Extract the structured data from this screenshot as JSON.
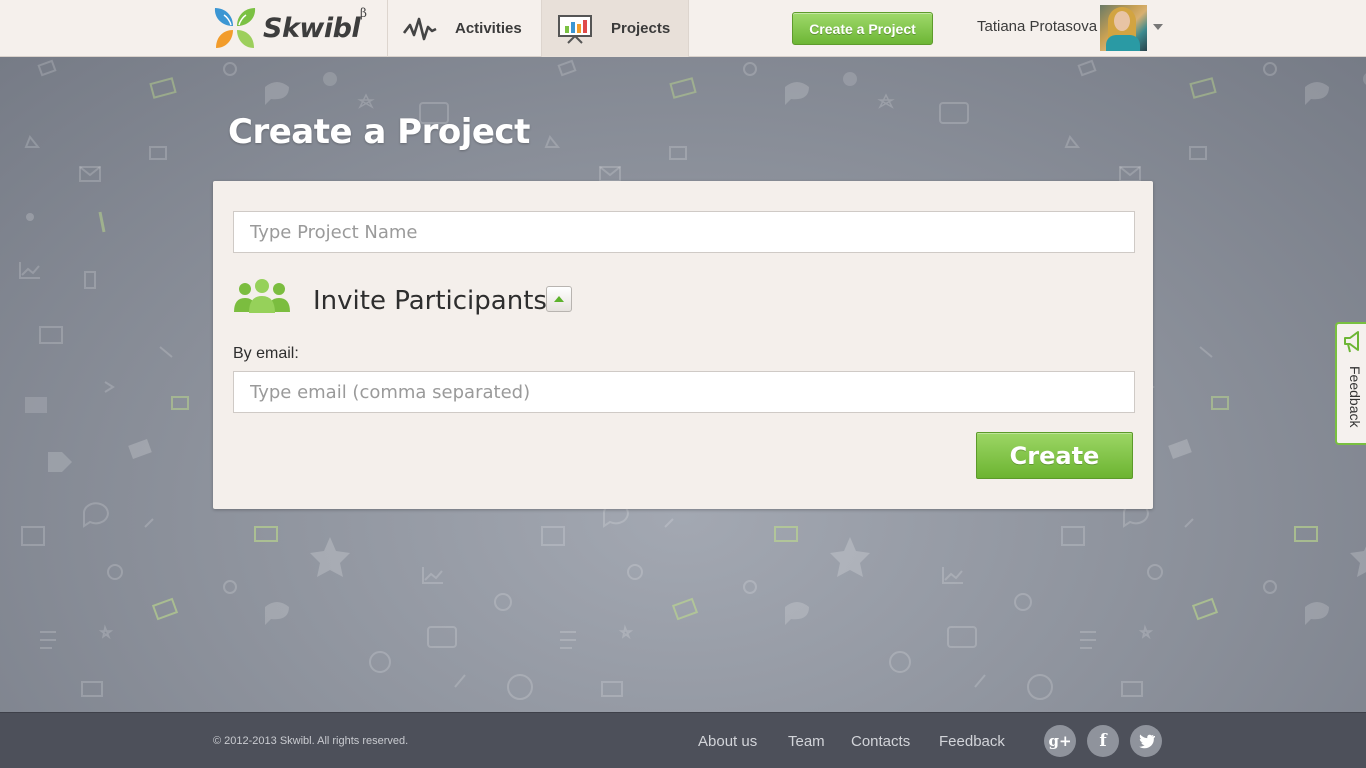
{
  "header": {
    "logo_text": "Skwibl",
    "logo_beta": "β",
    "nav": [
      {
        "label": "Activities",
        "icon": "activity-graph-icon"
      },
      {
        "label": "Projects",
        "icon": "presentation-board-icon",
        "active": true
      }
    ],
    "create_button": "Create a Project",
    "user_name": "Tatiana Protasova"
  },
  "main": {
    "title": "Create a Project",
    "project_name": {
      "value": "",
      "placeholder": "Type Project Name"
    },
    "invite_title": "Invite Participants",
    "email_label": "By email:",
    "email_input": {
      "value": "",
      "placeholder": "Type email (comma separated)"
    },
    "submit_button": "Create"
  },
  "feedback_tab": {
    "label": "Feedback"
  },
  "footer": {
    "copyright": "© 2012-2013 Skwibl. All rights reserved.",
    "links": [
      "About us",
      "Team",
      "Contacts",
      "Feedback"
    ],
    "social": [
      {
        "name": "google-plus-icon",
        "glyph": "g+"
      },
      {
        "name": "facebook-icon",
        "glyph": "f"
      },
      {
        "name": "twitter-icon",
        "glyph": "t"
      }
    ]
  },
  "colors": {
    "accent_green": "#6db635",
    "header_bg": "#f5f0ec",
    "footer_bg": "#4d505a",
    "page_bg": "#8e939d"
  }
}
